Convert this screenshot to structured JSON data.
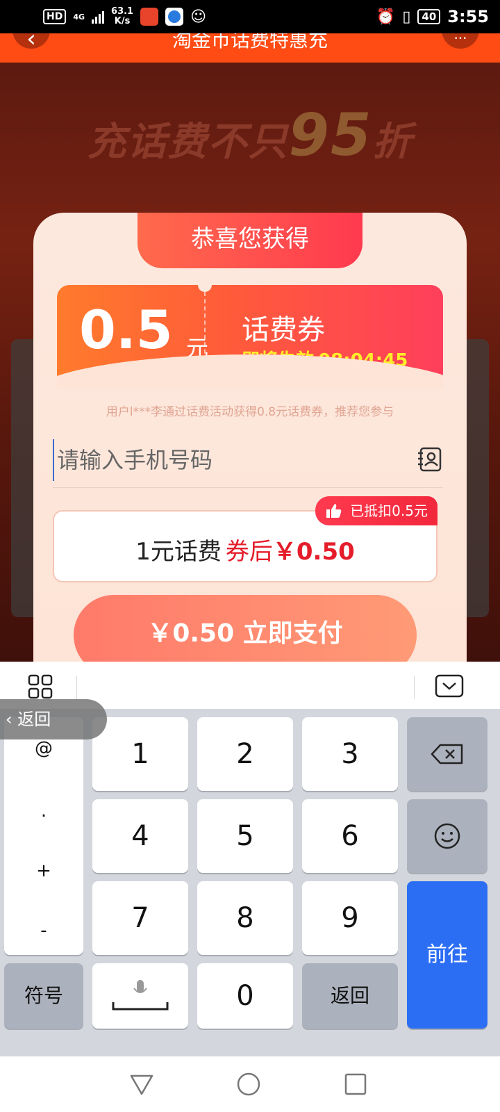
{
  "status_bar": {
    "hd": "HD",
    "network": "4G",
    "speed_value": "63.1",
    "speed_unit": "K/s",
    "battery": "40",
    "time": "3:55"
  },
  "header": {
    "title": "淘金币话费特惠充",
    "more": "···"
  },
  "banner": {
    "text": "充话费不只",
    "highlight": "95",
    "suffix": "折"
  },
  "popup": {
    "tab_title": "恭喜您获得",
    "coupon": {
      "amount": "0.5",
      "unit": "元",
      "type": "话费券",
      "expire_label": "即将失效",
      "countdown": "08:04:45"
    },
    "notice": "用户l***李通过话费活动获得0.8元话费券，推荐您参与",
    "phone_placeholder": "请输入手机号码",
    "product": {
      "name": "1元话费",
      "after_label": "券后",
      "price": "￥0.50",
      "badge": "已抵扣0.5元"
    },
    "pay_button": "￥0.50 立即支付"
  },
  "keyboard": {
    "return_tip": "返回",
    "symbols": [
      "@",
      ".",
      "+",
      "-"
    ],
    "digits": [
      "1",
      "2",
      "3",
      "4",
      "5",
      "6",
      "7",
      "8",
      "9",
      "0"
    ],
    "symbols_key": "符号",
    "return_key": "返回",
    "go_key": "前往"
  }
}
